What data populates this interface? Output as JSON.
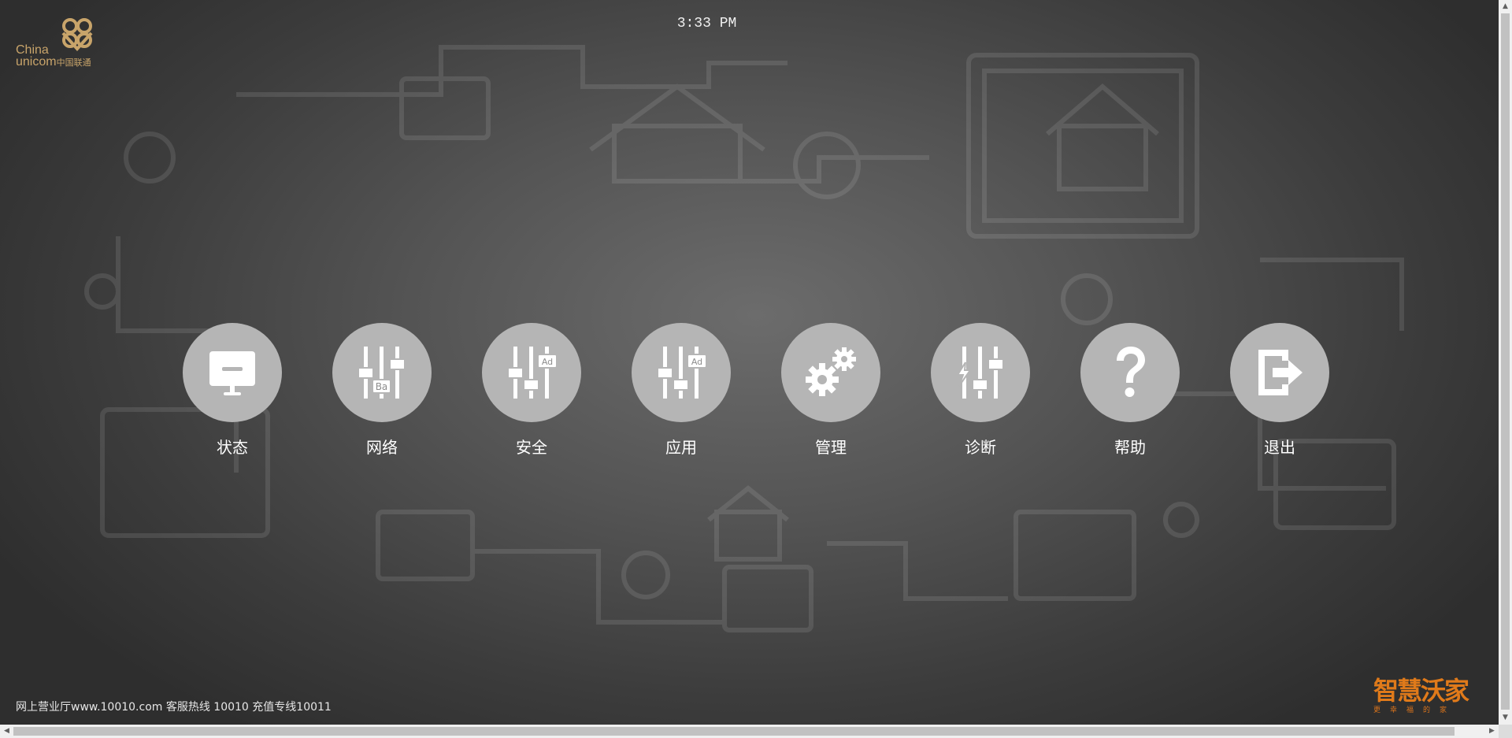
{
  "header": {
    "logo_name": "China Unicom",
    "logo_text_line1": "China",
    "logo_text_line2": "unicom",
    "logo_text_cn": "中国联通",
    "clock": "3:33 PM"
  },
  "menu": [
    {
      "label": "状态",
      "icon": "monitor-icon"
    },
    {
      "label": "网络",
      "icon": "sliders-ba-icon",
      "badge": "Ba"
    },
    {
      "label": "安全",
      "icon": "sliders-ad-icon",
      "badge": "Ad"
    },
    {
      "label": "应用",
      "icon": "sliders-ad-icon",
      "badge": "Ad"
    },
    {
      "label": "管理",
      "icon": "gears-icon"
    },
    {
      "label": "诊断",
      "icon": "sliders-bolt-icon"
    },
    {
      "label": "帮助",
      "icon": "question-icon"
    },
    {
      "label": "退出",
      "icon": "logout-icon"
    }
  ],
  "footer": {
    "text": "网上营业厅www.10010.com 客服热线 10010 充值专线10011",
    "brand_main": "智慧沃家",
    "brand_sub": "更幸福的家"
  },
  "colors": {
    "circle": "#b5b5b5",
    "brand": "#e07a1a",
    "logo_gold": "#c8a46a"
  }
}
